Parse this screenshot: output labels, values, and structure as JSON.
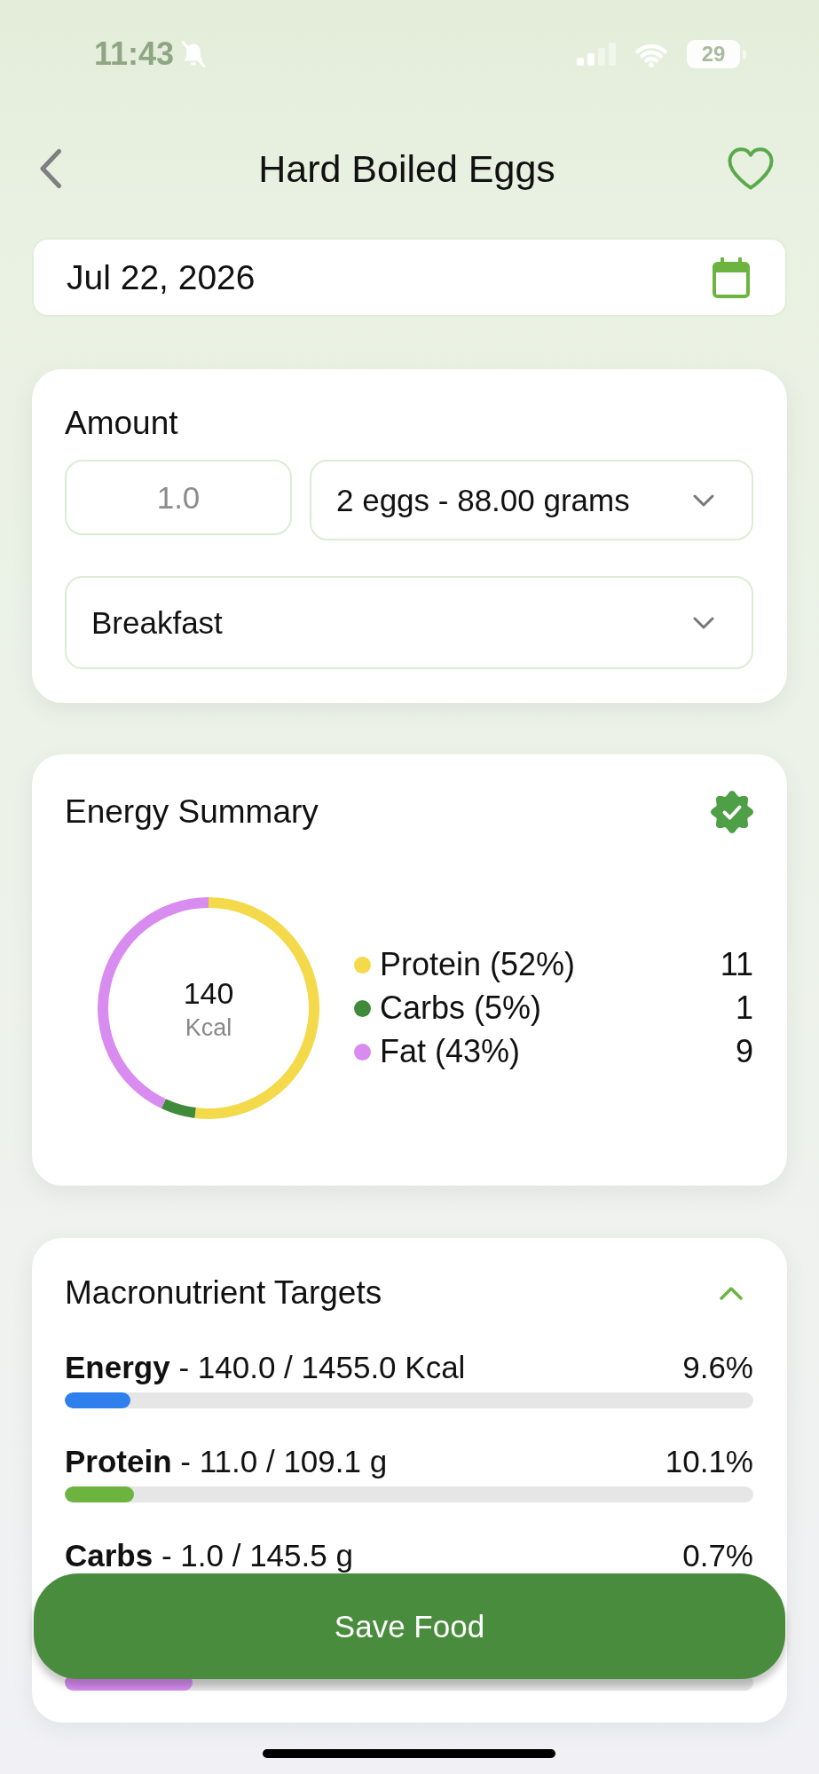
{
  "status_bar": {
    "time": "11:43",
    "battery": "29"
  },
  "header": {
    "title": "Hard Boiled Eggs",
    "favorite": false
  },
  "date_field": {
    "value": "Jul 22, 2026"
  },
  "amount_card": {
    "title": "Amount",
    "quantity": {
      "placeholder": "1.0"
    },
    "serving": {
      "value": "2 eggs - 88.00 grams"
    },
    "meal": {
      "value": "Breakfast"
    }
  },
  "energy_summary": {
    "title": "Energy Summary",
    "verified": true,
    "total": "140",
    "unit": "Kcal",
    "chart_data": {
      "type": "donut",
      "values": [
        52,
        5,
        43
      ]
    },
    "legend": [
      {
        "label": "Protein (52%)",
        "value": "11",
        "color": "#f4d94b"
      },
      {
        "label": "Carbs (5%)",
        "value": "1",
        "color": "#3f8b3a"
      },
      {
        "label": "Fat (43%)",
        "value": "9",
        "color": "#d98cf0"
      }
    ]
  },
  "macro_targets": {
    "title": "Macronutrient Targets",
    "expanded": true,
    "rows": [
      {
        "label": "**Energy** - 140.0 / 1455.0 Kcal",
        "percent": "9.6%",
        "level": 0.096,
        "color": "#2f80ed"
      },
      {
        "label": "**Protein** - 11.0 / 109.1 g",
        "percent": "10.1%",
        "level": 0.101,
        "color": "#6db33f"
      },
      {
        "label": "**Carbs** - 1.0 / 145.5 g",
        "percent": "0.7%"
      },
      {
        "level": 0.186,
        "color": "#d68cf0"
      }
    ]
  },
  "save_button": {
    "label": "Save Food"
  }
}
